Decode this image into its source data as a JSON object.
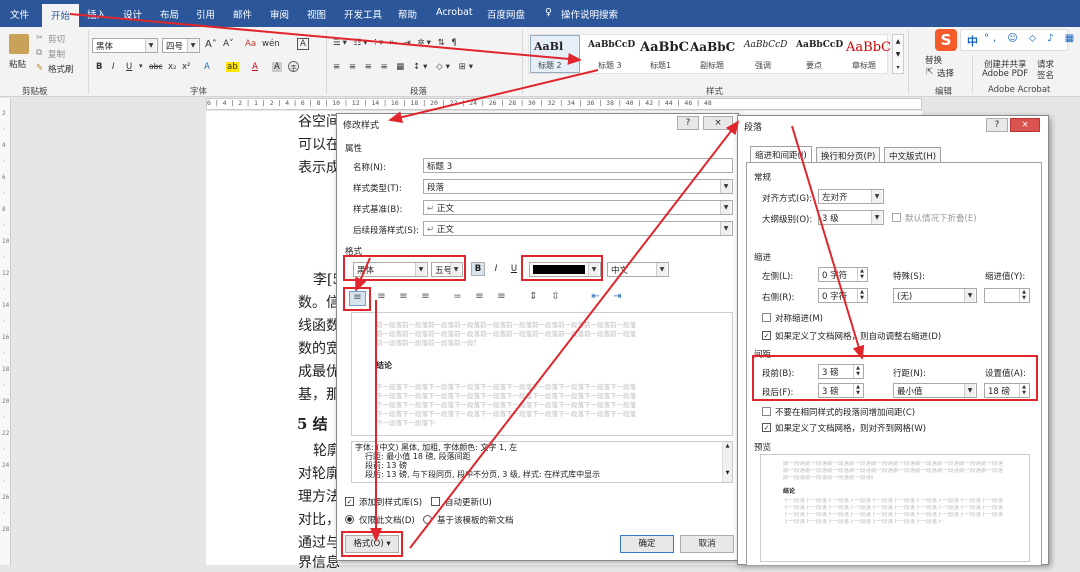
{
  "tabs": [
    "文件",
    "开始",
    "插入",
    "设计",
    "布局",
    "引用",
    "邮件",
    "审阅",
    "视图",
    "开发工具",
    "帮助",
    "Acrobat",
    "百度网盘",
    "操作说明搜索"
  ],
  "clipboard": {
    "paste": "粘贴",
    "cut": "剪切",
    "copy": "复制",
    "painter": "格式刷",
    "group": "剪贴板"
  },
  "font": {
    "name": "黑体",
    "size": "四号",
    "group": "字体"
  },
  "paragraph": {
    "group": "段落"
  },
  "styles": {
    "group": "样式",
    "previews": [
      "AaBl",
      "AaBbCcD",
      "AaBbC",
      "AaBbC",
      "AaBbCcD",
      "AaBbCcD",
      "AaBbC"
    ],
    "names": [
      "标题 2",
      "标题 3",
      "标题1",
      "副标题",
      "强调",
      "要点",
      "章标题"
    ]
  },
  "edit": {
    "replace": "替换",
    "select": "选择",
    "group": "编辑"
  },
  "acrobat": {
    "create": "创建并共享",
    "pdf": "Adobe PDF",
    "request": "请求",
    "sign": "签名",
    "group": "Adobe Acrobat"
  },
  "ime": {
    "logo": "S",
    "lang": "中"
  },
  "ruler_text": "6 | 4 | 2 | 1 | 2 | 4 | 6 | 8 | 10 | 12 | 14 | 16 | 18 | 20 | 22 | 24 | 26 | 28 | 30 | 32 | 34 | 36 | 38 | 40 | 42 | 44 | 46 | 48",
  "doc": {
    "lines": [
      "谷空间",
      "可以在",
      "表示成",
      "李[5",
      "数。信",
      "线函数",
      "数的宽",
      "成最优",
      "基，那",
      "5 结",
      "轮廓",
      "对轮廓",
      "理方法",
      "对比，",
      "通过与",
      "界信息"
    ]
  },
  "modify": {
    "title": "修改样式",
    "help": "?",
    "close": "×",
    "props": "属性",
    "name_lbl": "名称(N):",
    "name_val": "标题 3",
    "type_lbl": "样式类型(T):",
    "type_val": "段落",
    "base_lbl": "样式基准(B):",
    "base_val": "正文",
    "next_lbl": "后续段落样式(S):",
    "next_val": "正文",
    "format": "格式",
    "font_val": "黑体",
    "size_val": "五号",
    "bold": "B",
    "italic": "I",
    "underline": "U",
    "lang_val": "中文",
    "preview_prev": "前一段落前一段落前一段落前一段落前一段落前一段落前一段落前一段落前一段落前一段落",
    "preview_word": "结论",
    "preview_next": "下一段落下一段落下一段落下一段落下一段落下一段落下一段落下一段落下一段落下一段落",
    "desc": [
      "字体: (中文) 黑体, 加粗, 字体颜色: 文字 1, 左",
      "行距: 最小值 18 磅, 段落间距",
      "段前: 13 磅",
      "段后: 13 磅, 与下段同页, 段中不分页, 3 级, 样式: 在样式库中显示"
    ],
    "add_lib": "添加到样式库(S)",
    "auto_update": "自动更新(U)",
    "only_doc": "仅限此文档(D)",
    "new_doc": "基于该模板的新文档",
    "format_btn": "格式(O) ▾",
    "ok": "确定",
    "cancel": "取消"
  },
  "para": {
    "title": "段落",
    "help": "?",
    "close": "×",
    "tabs": [
      "缩进和间距(I)",
      "换行和分页(P)",
      "中文版式(H)"
    ],
    "general": "常规",
    "align_lbl": "对齐方式(G):",
    "align_val": "左对齐",
    "outline_lbl": "大纲级别(O):",
    "outline_val": "3 级",
    "collapse": "默认情况下折叠(E)",
    "indent": "缩进",
    "left_lbl": "左侧(L):",
    "left_val": "0 字符",
    "right_lbl": "右侧(R):",
    "right_val": "0 字符",
    "special_lbl": "特殊(S):",
    "special_val": "(无)",
    "by_lbl": "缩进值(Y):",
    "mirror": "对称缩进(M)",
    "auto_indent": "如果定义了文档网格，则自动调整右缩进(D)",
    "spacing": "间距",
    "before_lbl": "段前(B):",
    "before_val": "3 磅",
    "after_lbl": "段后(F):",
    "after_val": "3 磅",
    "line_lbl": "行距(N):",
    "line_val": "最小值",
    "at_lbl": "设置值(A):",
    "at_val": "18 磅",
    "no_space": "不要在相同样式的段落间增加间距(C)",
    "snap": "如果定义了文档网格，则对齐到网格(W)",
    "preview": "预览",
    "pv_prev": "前一段落前一段落前一段落前一段落前一段落前一段落前一段落前一段落前一段落前一段落",
    "pv_word": "结论",
    "pv_next": "下一段落下一段落下一段落下一段落下一段落下一段落下一段落下一段落下一段落下一段落"
  }
}
